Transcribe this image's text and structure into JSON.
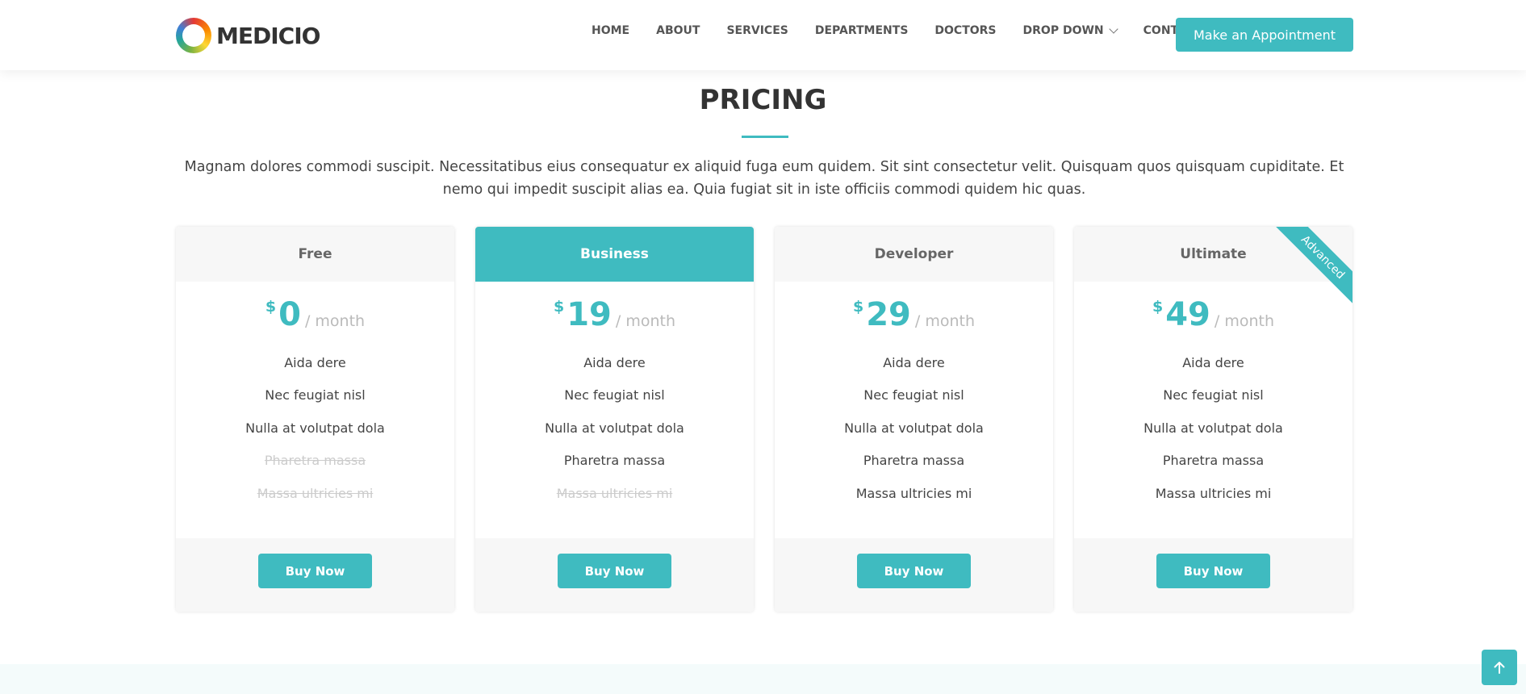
{
  "brand": {
    "name": "MEDICIO",
    "icon": "logo-ring-icon"
  },
  "nav": {
    "items": [
      "HOME",
      "ABOUT",
      "SERVICES",
      "DEPARTMENTS",
      "DOCTORS",
      "DROP DOWN",
      "CONTACT"
    ],
    "cta_label": "Make an Appointment"
  },
  "section": {
    "title": "PRICING",
    "description": "Magnam dolores commodi suscipit. Necessitatibus eius consequatur ex aliquid fuga eum quidem. Sit sint consectetur velit. Quisquam quos quisquam cupiditate. Et nemo qui impedit suscipit alias ea. Quia fugiat sit in iste officiis commodi quidem hic quas."
  },
  "plans": [
    {
      "name": "Free",
      "currency": "$",
      "amount": "0",
      "period": "/ month",
      "featured": false,
      "ribbon": "",
      "features": [
        {
          "text": "Aida dere",
          "available": true
        },
        {
          "text": "Nec feugiat nisl",
          "available": true
        },
        {
          "text": "Nulla at volutpat dola",
          "available": true
        },
        {
          "text": "Pharetra massa",
          "available": false
        },
        {
          "text": "Massa ultricies mi",
          "available": false
        }
      ],
      "button": "Buy Now"
    },
    {
      "name": "Business",
      "currency": "$",
      "amount": "19",
      "period": "/ month",
      "featured": true,
      "ribbon": "",
      "features": [
        {
          "text": "Aida dere",
          "available": true
        },
        {
          "text": "Nec feugiat nisl",
          "available": true
        },
        {
          "text": "Nulla at volutpat dola",
          "available": true
        },
        {
          "text": "Pharetra massa",
          "available": true
        },
        {
          "text": "Massa ultricies mi",
          "available": false
        }
      ],
      "button": "Buy Now"
    },
    {
      "name": "Developer",
      "currency": "$",
      "amount": "29",
      "period": "/ month",
      "featured": false,
      "ribbon": "",
      "features": [
        {
          "text": "Aida dere",
          "available": true
        },
        {
          "text": "Nec feugiat nisl",
          "available": true
        },
        {
          "text": "Nulla at volutpat dola",
          "available": true
        },
        {
          "text": "Pharetra massa",
          "available": true
        },
        {
          "text": "Massa ultricies mi",
          "available": true
        }
      ],
      "button": "Buy Now"
    },
    {
      "name": "Ultimate",
      "currency": "$",
      "amount": "49",
      "period": "/ month",
      "featured": false,
      "ribbon": "Advanced",
      "features": [
        {
          "text": "Aida dere",
          "available": true
        },
        {
          "text": "Nec feugiat nisl",
          "available": true
        },
        {
          "text": "Nulla at volutpat dola",
          "available": true
        },
        {
          "text": "Pharetra massa",
          "available": true
        },
        {
          "text": "Massa ultricies mi",
          "available": true
        }
      ],
      "button": "Buy Now"
    }
  ],
  "back_to_top": {
    "icon": "arrow-up-icon"
  },
  "colors": {
    "accent": "#3fbbc0",
    "heading": "#333333",
    "muted": "#bababa",
    "disabled": "#cccccc"
  }
}
